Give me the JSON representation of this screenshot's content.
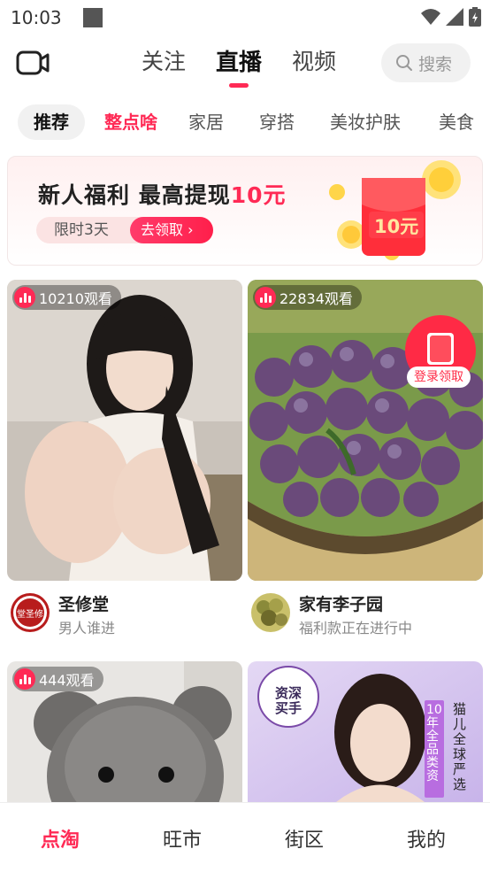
{
  "status": {
    "time": "10:03"
  },
  "top_nav": {
    "tabs": [
      {
        "label": "关注"
      },
      {
        "label": "直播"
      },
      {
        "label": "视频"
      }
    ],
    "search_label": "搜索"
  },
  "categories": [
    "推荐",
    "整点啥",
    "家居",
    "穿搭",
    "美妆护肤",
    "美食"
  ],
  "promo": {
    "title_prefix": "新人福利 最高提现",
    "title_amount": "10元",
    "limit_text": "限时3天",
    "cta": "去领取 ›",
    "envelope_amount": "10元"
  },
  "cards": [
    {
      "viewers": "10210观看",
      "shop": "圣修堂",
      "subtitle": "男人谁进",
      "avatar_text": "堂圣修"
    },
    {
      "viewers": "22834观看",
      "shop": "家有李子园",
      "subtitle": "福利款正在进行中",
      "badge": "登录领取"
    },
    {
      "viewers": "444观看"
    },
    {
      "viewers": "",
      "seal": "资深买手",
      "vertical_text": "猫儿全球严选",
      "vertical_badge": "10年全品类资"
    }
  ],
  "bottom_nav": [
    "点淘",
    "旺市",
    "街区",
    "我的"
  ],
  "colors": {
    "accent": "#ff2a55"
  }
}
